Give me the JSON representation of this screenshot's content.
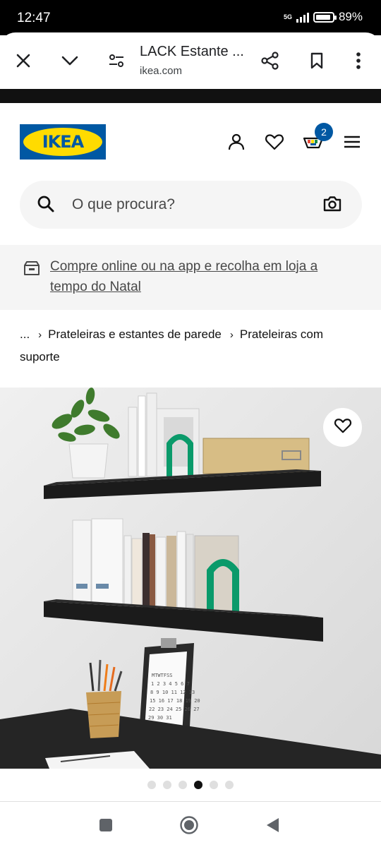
{
  "status_bar": {
    "time": "12:47",
    "network": "5G",
    "battery": "89%",
    "battery_level": 0.89
  },
  "browser": {
    "title": "LACK Estante ...",
    "url": "ikea.com",
    "icons": [
      "close-icon",
      "chevron-down-icon",
      "page-info-icon",
      "share-icon",
      "bookmark-icon",
      "more-vert-icon"
    ]
  },
  "header": {
    "logo_text": "IKEA",
    "cart_count": "2",
    "icons": [
      "person-icon",
      "heart-icon",
      "cart-icon",
      "menu-icon"
    ]
  },
  "search": {
    "placeholder": "O que procura?",
    "icons": [
      "search-icon",
      "camera-icon"
    ]
  },
  "promo": {
    "text": "Compre online ou na app e recolha em loja a tempo do Natal",
    "icon": "store-icon"
  },
  "breadcrumb": {
    "items": [
      "...",
      "Prateleiras e estantes de parede",
      "Prateleiras com suporte"
    ]
  },
  "gallery": {
    "image_count": 6,
    "active_index": 3,
    "favorite_icon": "heart-icon"
  },
  "colors": {
    "ikea_blue": "#0058a3",
    "ikea_yellow": "#ffdb00",
    "light_gray": "#f5f5f5",
    "shelf_black": "#1b1b1b",
    "bookend_green": "#0a9a6a"
  }
}
